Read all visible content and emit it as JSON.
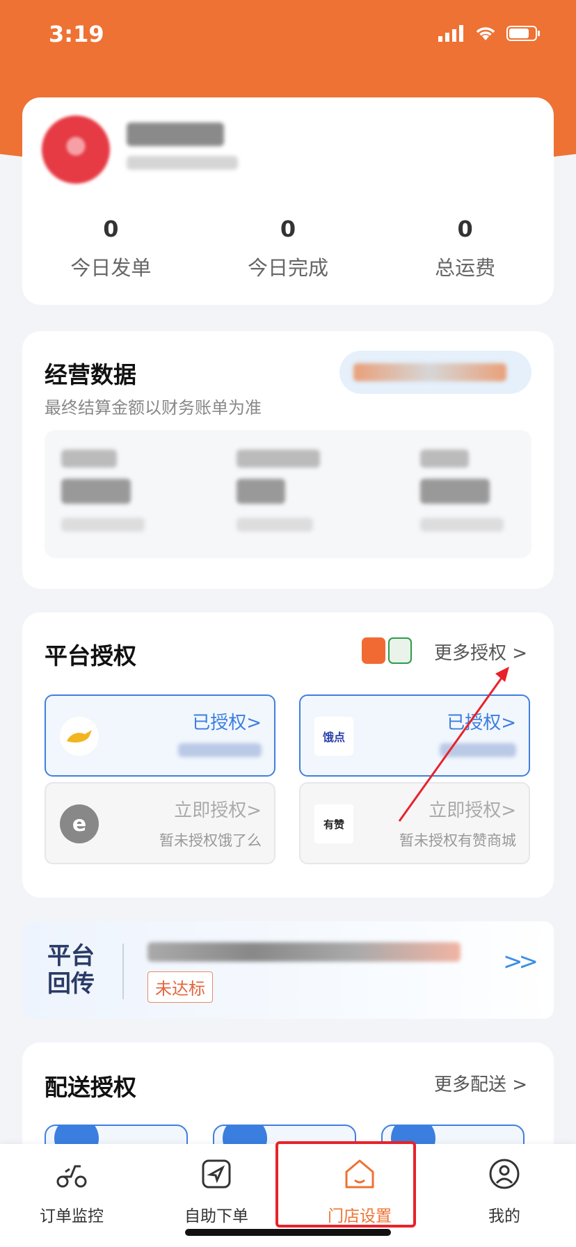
{
  "status_bar": {
    "time": "3:19"
  },
  "profile": {
    "stats": [
      {
        "value": "0",
        "label": "今日发单"
      },
      {
        "value": "0",
        "label": "今日完成"
      },
      {
        "value": "0",
        "label": "总运费"
      }
    ]
  },
  "business": {
    "title": "经营数据",
    "subtitle": "最终结算金额以财务账单为准"
  },
  "platform_auth": {
    "title": "平台授权",
    "more": "更多授权 >",
    "tiles": [
      {
        "status": "已授权>",
        "note": "",
        "logo": "kangaroo-logo"
      },
      {
        "status": "已授权>",
        "note": "",
        "logo": "饿点"
      },
      {
        "status": "立即授权>",
        "note": "暂未授权饿了么",
        "logo": "eleme-logo"
      },
      {
        "status": "立即授权>",
        "note": "暂未授权有赞商城",
        "logo": "有赞"
      }
    ]
  },
  "callback": {
    "title": "平台回传",
    "badge": "未达标",
    "arrow": ">>"
  },
  "delivery_auth": {
    "title": "配送授权",
    "more": "更多配送 >"
  },
  "tabbar": {
    "tabs": [
      {
        "label": "订单监控"
      },
      {
        "label": "自助下单"
      },
      {
        "label": "门店设置"
      },
      {
        "label": "我的"
      }
    ],
    "active_color": "#ee7233"
  }
}
